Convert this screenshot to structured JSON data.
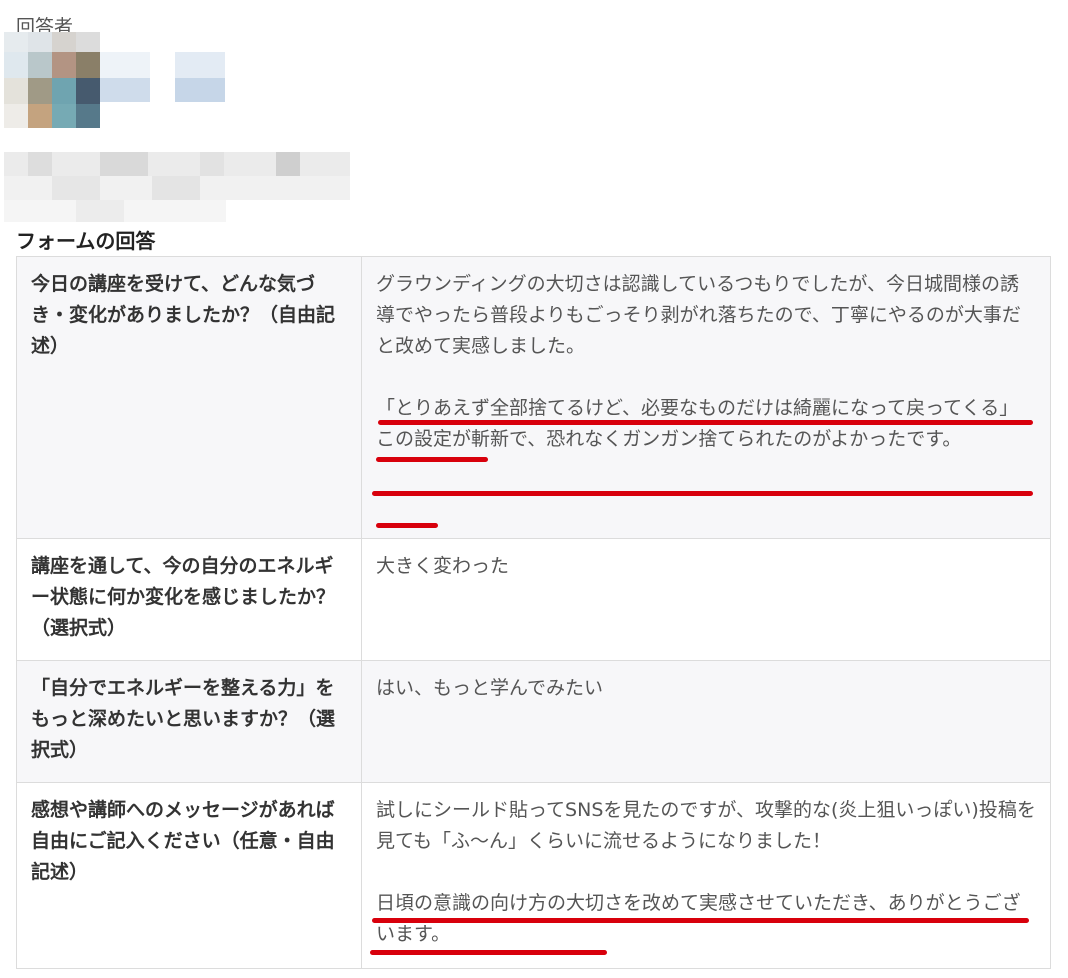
{
  "respondent": {
    "label": "回答者"
  },
  "section_title": "フォームの回答",
  "rows": [
    {
      "question": "今日の講座を受けて、どんな気づき・変化がありましたか？（自由記述）",
      "answer_p1": "グラウンディングの大切さは認識しているつもりでしたが、今日城間様の誘導でやったら普段よりもごっそり剥がれ落ちたので、丁寧にやるのが大事だと改めて実感しました。",
      "answer_p2_a": "「とりあえず全部捨てるけど、必要なものだけは綺麗になって戻ってくる」",
      "answer_p2_b": "この設定が斬新で、恐れなくガンガン捨てられたのがよかったです。"
    },
    {
      "question": "講座を通して、今の自分のエネルギー状態に何か変化を感じましたか？（選択式）",
      "answer": "大きく変わった"
    },
    {
      "question": "「自分でエネルギーを整える力」をもっと深めたいと思いますか？（選択式）",
      "answer": "はい、もっと学んでみたい"
    },
    {
      "question": "感想や講師へのメッセージがあれば自由にご記入ください（任意・自由記述）",
      "answer_p1": "試しにシールド貼ってSNSを見たのですが、攻撃的な(炎上狙いっぽい)投稿を見ても「ふ〜ん」くらいに流せるようになりました！",
      "answer_p2": "日頃の意識の向け方の大切さを改めて実感させていただき、ありがとうございます。"
    }
  ],
  "colors": {
    "underline": "#d8000c",
    "border": "#dcdcdc",
    "alt_row": "#f7f7f9"
  }
}
